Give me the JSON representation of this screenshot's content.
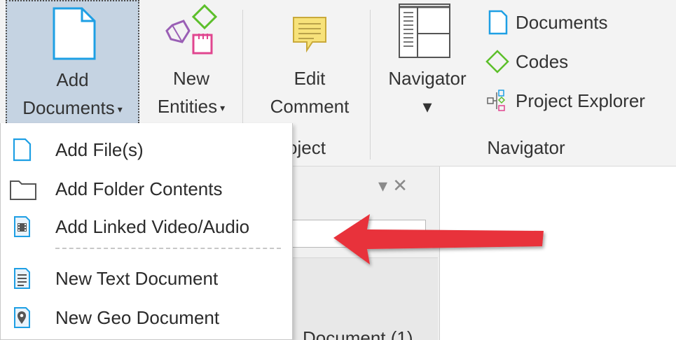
{
  "ribbon": {
    "add_documents": {
      "line1": "Add",
      "line2": "Documents",
      "caret": "▾"
    },
    "new_entities": {
      "line1": "New",
      "line2": "Entities",
      "caret": "▾"
    },
    "edit_comment": {
      "line1": "Edit",
      "line2": "Comment"
    },
    "navigator_button": {
      "line1": "Navigator",
      "caret": "▾"
    },
    "small_buttons": {
      "documents": "Documents",
      "codes": "Codes",
      "project_explorer": "Project Explorer"
    },
    "groups": {
      "project": "oject",
      "navigator": "Navigator"
    }
  },
  "dropdown_menu": {
    "items": [
      {
        "label": "Add File(s)",
        "icon": "file-icon"
      },
      {
        "label": "Add Folder Contents",
        "icon": "folder-icon"
      },
      {
        "label": "Add Linked Video/Audio",
        "icon": "film-icon"
      },
      {
        "label": "New Text Document",
        "icon": "text-document-icon"
      },
      {
        "label": "New Geo Document",
        "icon": "map-pin-icon"
      }
    ]
  },
  "pane": {
    "controls": "▾ ✕",
    "partial_text": "Document (1)"
  },
  "colors": {
    "accent_blue": "#1e9fe4",
    "code_green": "#5cbf2a",
    "selected_bg": "#c5d3e2",
    "arrow_red": "#e8333a"
  }
}
